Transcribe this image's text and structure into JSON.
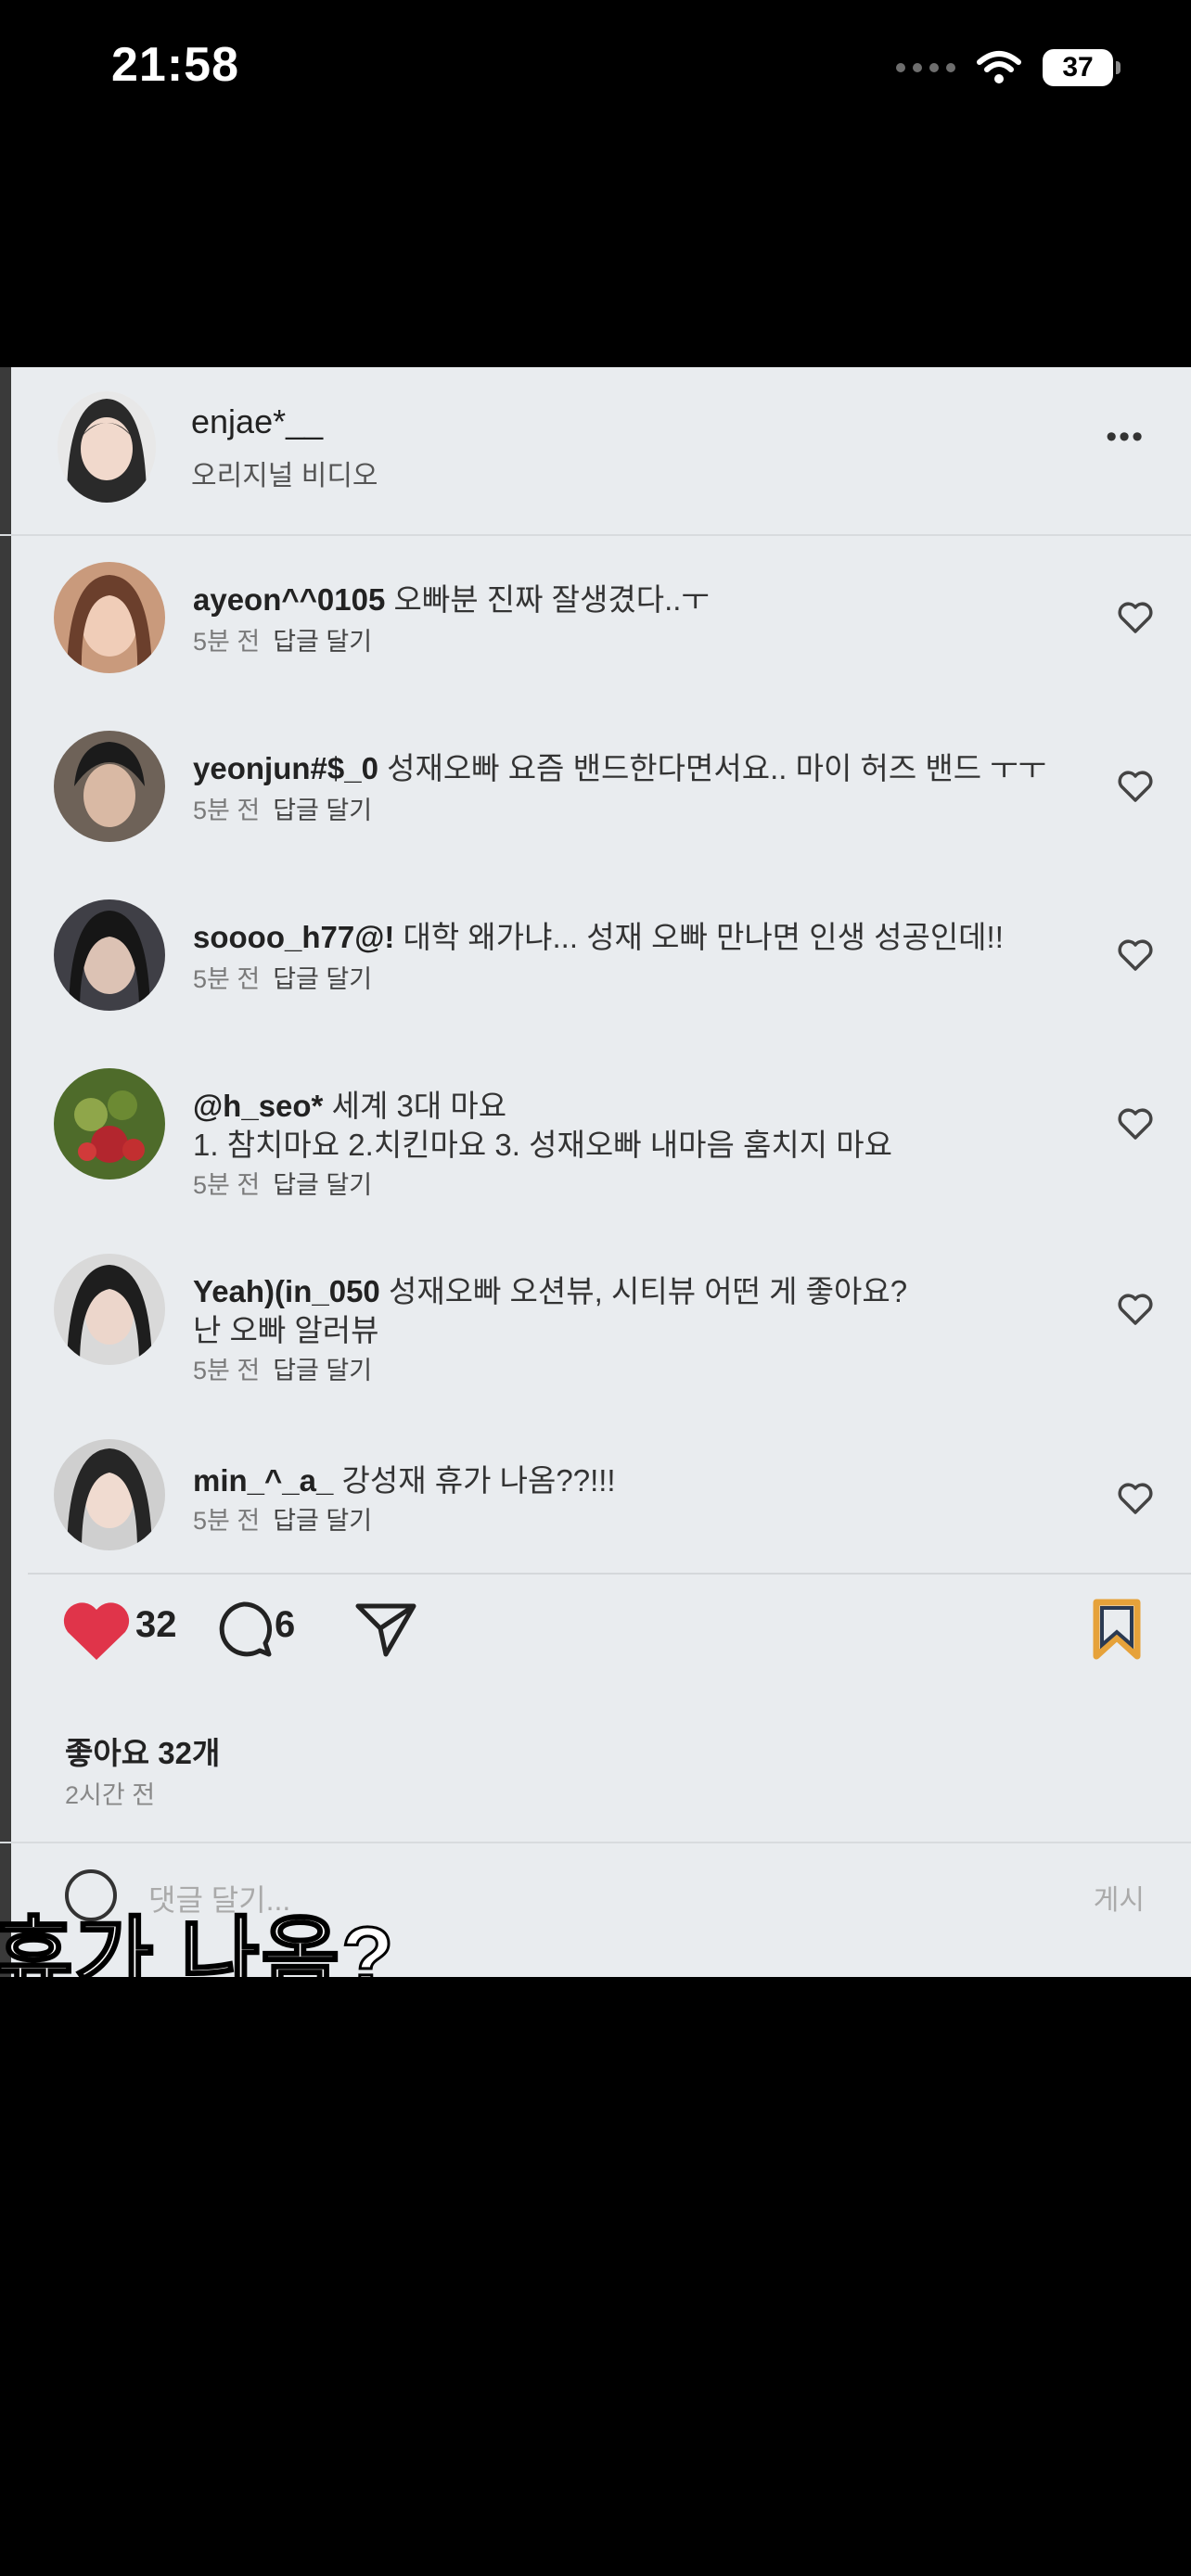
{
  "status_bar": {
    "time": "21:58",
    "battery": "37"
  },
  "post": {
    "owner": {
      "username": "enjae*__",
      "subtitle": "오리지널 비디오"
    },
    "comments": [
      {
        "username": "ayeon^^0105",
        "text": "오빠분 진짜 잘생겼다..ㅜ",
        "time": "5분 전",
        "reply": "답글 달기"
      },
      {
        "username": "yeonjun#$_0",
        "text": "성재오빠 요즘 밴드한다면서요.. 마이 허즈 밴드 ㅜㅜ",
        "time": "5분 전",
        "reply": "답글 달기"
      },
      {
        "username": "soooo_h77@!",
        "text": "대학 왜가냐... 성재 오빠 만나면 인생 성공인데!!",
        "time": "5분 전",
        "reply": "답글 달기"
      },
      {
        "username": "@h_seo*",
        "text": "세계 3대 마요",
        "text2": "1. 참치마요 2.치킨마요 3. 성재오빠 내마음 훔치지 마요",
        "time": "5분 전",
        "reply": "답글 달기"
      },
      {
        "username": "Yeah)(in_050",
        "text": "성재오빠 오션뷰, 시티뷰 어떤 게 좋아요?",
        "text2": "난 오빠 알러뷰",
        "time": "5분 전",
        "reply": "답글 달기"
      },
      {
        "username": "min_^_a_",
        "text": "강성재 휴가 나옴??!!!",
        "time": "5분 전",
        "reply": "답글 달기"
      }
    ],
    "actions": {
      "like_count": "32",
      "comment_count": "6"
    },
    "likes_text": "좋아요 32개",
    "time_ago": "2시간 전",
    "add_comment": {
      "placeholder": "댓글 달기...",
      "post_label": "게시"
    }
  },
  "subtitle": "휴가 나옴?",
  "colors": {
    "heart": "#e0344a",
    "bookmark": "#e6a23a",
    "background": "#e9ecef"
  }
}
